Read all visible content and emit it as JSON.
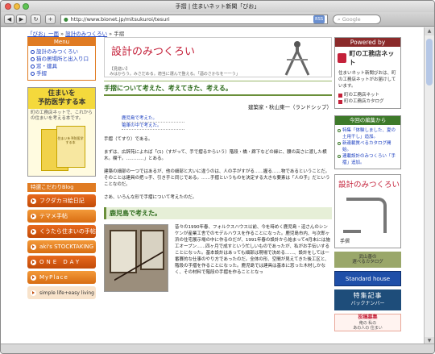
{
  "window": {
    "title": "手摺 | 住まいネット新聞「びお」"
  },
  "toolbar": {
    "url": "http://www.bionet.jp/mitsukuroi/tesuri",
    "rss": "RSS",
    "search_placeholder": "Google"
  },
  "breadcrumb": {
    "home": "「びお」一面",
    "section": "設計のみつくろい",
    "current": "手摺"
  },
  "left": {
    "menu_title": "Menu",
    "menu_items": [
      "設計のみつくろい",
      "猫の居場所と出入り口",
      "窓・建具",
      "手摺"
    ],
    "promo_title": "住まいを\n予防医学する本",
    "promo_text": "町の工務店ネットで、これからの住まいを考える本です。",
    "promo_book": "住まいを予防医学する本",
    "blog_header": "特選こだわりBlog",
    "blogs": [
      "フクダカヨ絵日記",
      "テマメ手帖",
      "くうたら住まいの手帖",
      "aki's STOCKTAKING",
      "ONE DAY",
      "MyPlace",
      "simple life+easy living"
    ]
  },
  "main": {
    "banner_title": "設計のみつくろい",
    "banner_sub": "【見繕い】\nみはからう。みさだめる。適当に選んで整える。「酒のさかなを一一う」",
    "heading": "手摺について考えた、考えてきた、考える。",
    "author": "建築家・秋山東一（ランドシップ）",
    "links": [
      "鹿児島で考えた。",
      "電車の中で考えた。"
    ],
    "para1": "手摺（てすり）である。",
    "para2": "まずは、広辞苑によれば「(1)（すがって、手で摺るからいう）階段・橋・廊下などの縁に、腰の高さに渡した横木。欄干。…………」とある。",
    "para3": "建築の細部の一つではあるが、他の細部と大いに違うのは、人の手がすがる……握る……物であるということだ。そのことは建具の把っ手、引き手と同じである。……手摺というものを決定する大きな要素は「人の手」だということなのだ。",
    "para4": "さあ、いろんな形で手摺について考えたのだ。",
    "heading2": "鹿児島で考えた。",
    "text2": "昔々の1990年春、フォルクスハウス以前、今を時めく鹿児島・迫さんのシンケンが産業工舎でのモデルハウスを作ることになった。鹿児島市内、与次郎ヶ浜の住宅展示場の中に作るのだが、1991年春の設計から始まって4月末には施工オープン……四ヶ月で成すという忙しいものであったが、私がお手伝いすることになった。基本設計はあっても細部は現場で決める……、設計をしては一番賽的な仕事のやり方であったのだ。全体の形、空間が見えてきた後工区と、階段の手摺を作ることになった。鹿児島では建具は基本に窓った木材しかなく、その材料で階段の手摺を作ることとなっ"
  },
  "right": {
    "powered": "Powered by",
    "logo": "町の工務店ネット",
    "desc": "住まいネット新聞びおは、町の工務店ネットがお届けしています。",
    "links": [
      "町の工務店ネット",
      "町の工務店カタログ"
    ],
    "news_title": "今回の編集から",
    "news": [
      "特集「体験しました、夏の土用干し」追加。",
      "新連載質べるカタログ開始。",
      "連載設計のみつくろい「手摺」追加。"
    ],
    "tekk_title": "設計のみつくろい",
    "tekk_label": "手摺",
    "ad1": "武山善の\n選べるカタログ",
    "ad2": "Standard house",
    "ad3_main": "特集記事",
    "ad3_sub": "バックナンバー",
    "ad4_main": "投稿募集",
    "ad4_sub": "俺の 私の\nあの人の 住まい"
  }
}
